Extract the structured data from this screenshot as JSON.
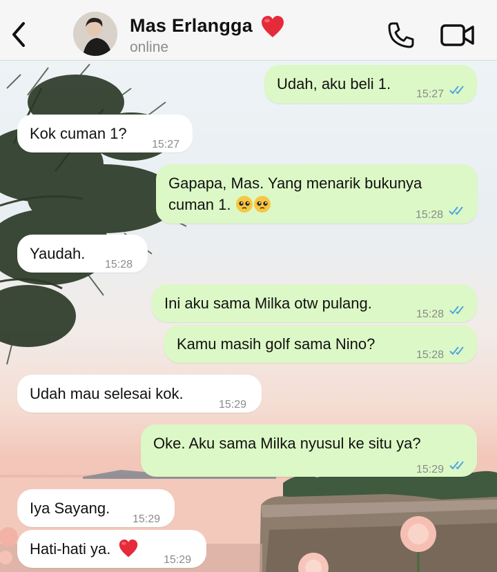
{
  "header": {
    "back_label": "Back",
    "contact_name": "Mas Erlangga",
    "status": "online"
  },
  "colors": {
    "incoming_bubble": "#ffffff",
    "outgoing_bubble": "#dcf8c6",
    "read_ticks": "#4fa3e0"
  },
  "messages": [
    {
      "dir": "out",
      "text": "Udah, aku beli 1.",
      "time": "15:27",
      "read": true
    },
    {
      "dir": "in",
      "text": "Kok cuman 1?",
      "time": "15:27"
    },
    {
      "dir": "out",
      "text": "Gapapa, Mas. Yang menarik bukunya",
      "text2": "cuman 1.",
      "emoji": "pleading-face x2",
      "time": "15:28",
      "read": true
    },
    {
      "dir": "in",
      "text": "Yaudah.",
      "time": "15:28"
    },
    {
      "dir": "out",
      "text": "Ini aku sama Milka otw pulang.",
      "time": "15:28",
      "read": true
    },
    {
      "dir": "out",
      "text": "Kamu masih golf sama Nino?",
      "time": "15:28",
      "read": true
    },
    {
      "dir": "in",
      "text": "Udah mau selesai kok.",
      "time": "15:29"
    },
    {
      "dir": "out",
      "text": "Oke. Aku sama Milka nyusul ke situ ya?",
      "time": "15:29",
      "read": true
    },
    {
      "dir": "in",
      "text": "Iya Sayang.",
      "time": "15:29"
    },
    {
      "dir": "in",
      "text": "Hati-hati ya.",
      "emoji": "red-heart",
      "time": "15:29"
    }
  ]
}
